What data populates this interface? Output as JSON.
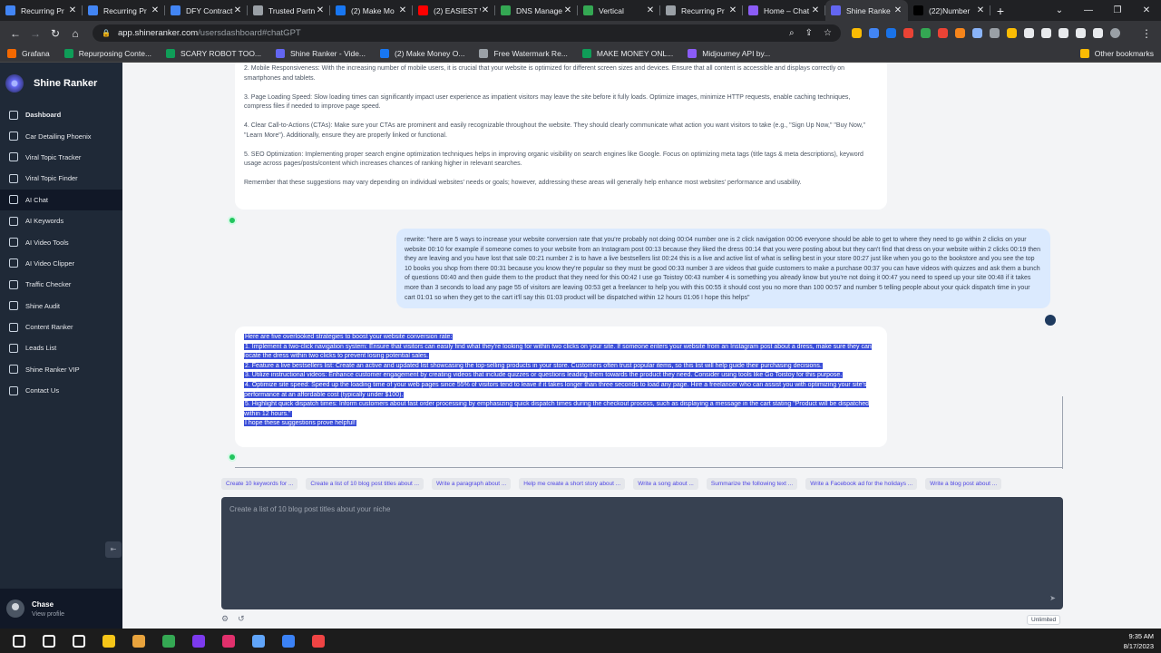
{
  "browser": {
    "tabs": [
      {
        "label": "Recurring Pr",
        "icon": "docs-icon",
        "color": "#4285f4"
      },
      {
        "label": "Recurring Pr",
        "icon": "docs-icon",
        "color": "#4285f4"
      },
      {
        "label": "DFY Contract",
        "icon": "docs-icon",
        "color": "#4285f4"
      },
      {
        "label": "Trusted Partn",
        "icon": "page-icon",
        "color": "#9aa0a6"
      },
      {
        "label": "(2) Make Mo",
        "icon": "facebook-icon",
        "color": "#1877f2"
      },
      {
        "label": "(2) EASIEST W",
        "icon": "youtube-icon",
        "color": "#ff0000"
      },
      {
        "label": "DNS Manage",
        "icon": "globe-icon",
        "color": "#34a853"
      },
      {
        "label": "Vertical",
        "icon": "globe-icon",
        "color": "#34a853"
      },
      {
        "label": "Recurring Pr",
        "icon": "page-icon",
        "color": "#9aa0a6"
      },
      {
        "label": "Home – Chat",
        "icon": "s-icon",
        "color": "#8b5cf6"
      },
      {
        "label": "Shine Ranke",
        "icon": "shine-ranker-icon",
        "color": "#6366f1",
        "active": true
      },
      {
        "label": "(22)Number",
        "icon": "tiktok-icon",
        "color": "#000000"
      }
    ],
    "url_host": "app.shineranker.com",
    "url_path": "/usersdashboard#chatGPT",
    "bookmarks": [
      {
        "label": "Grafana",
        "color": "#f46800"
      },
      {
        "label": "Repurposing Conte...",
        "color": "#0f9d58"
      },
      {
        "label": "SCARY ROBOT TOO...",
        "color": "#0f9d58"
      },
      {
        "label": "Shine Ranker - Vide...",
        "color": "#6366f1"
      },
      {
        "label": "(2) Make Money O...",
        "color": "#1877f2"
      },
      {
        "label": "Free Watermark Re...",
        "color": "#9aa0a6"
      },
      {
        "label": "MAKE MONEY ONL...",
        "color": "#0f9d58"
      },
      {
        "label": "Midjourney API by...",
        "color": "#8b5cf6"
      }
    ],
    "other_bookmarks": "Other bookmarks"
  },
  "sidebar": {
    "brand": "Shine Ranker",
    "items": [
      {
        "label": "Dashboard",
        "active": false,
        "bold": true
      },
      {
        "label": "Car Detailing Phoenix"
      },
      {
        "label": "Viral Topic Tracker"
      },
      {
        "label": "Viral Topic Finder"
      },
      {
        "label": "AI Chat",
        "active": true
      },
      {
        "label": "AI Keywords"
      },
      {
        "label": "AI Video Tools"
      },
      {
        "label": "AI Video Clipper"
      },
      {
        "label": "Traffic Checker"
      },
      {
        "label": "Shine Audit"
      },
      {
        "label": "Content Ranker"
      },
      {
        "label": "Leads List"
      },
      {
        "label": "Shine Ranker VIP"
      },
      {
        "label": "Contact Us"
      }
    ],
    "user": {
      "name": "Chase",
      "link": "View profile"
    }
  },
  "chat": {
    "assistant_prev": [
      "2. Mobile Responsiveness: With the increasing number of mobile users, it is crucial that your website is optimized for different screen sizes and devices. Ensure that all content is accessible and displays correctly on smartphones and tablets.",
      "3. Page Loading Speed: Slow loading times can significantly impact user experience as impatient visitors may leave the site before it fully loads. Optimize images, minimize HTTP requests, enable caching techniques, compress files if needed to improve page speed.",
      "4. Clear Call-to-Actions (CTAs): Make sure your CTAs are prominent and easily recognizable throughout the website. They should clearly communicate what action you want visitors to take (e.g., \"Sign Up Now,\" \"Buy Now,\" \"Learn More\"). Additionally, ensure they are properly linked or functional.",
      "5. SEO Optimization: Implementing proper search engine optimization techniques helps in improving organic visibility on search engines like Google. Focus on optimizing meta tags (title tags & meta descriptions), keyword usage across pages/posts/content which increases chances of ranking higher in relevant searches.",
      "Remember that these suggestions may vary depending on individual websites' needs or goals; however, addressing these areas will generally help enhance most websites' performance and usability."
    ],
    "user_message": "rewrite: \"here are 5 ways to increase your website conversion rate that you're probably not doing 00:04 number one is 2 click navigation 00:06 everyone should be able to get to where they need to go within 2 clicks on your website 00:10 for example if someone comes to your website from an Instagram post 00:13 because they liked the dress 00:14 that you were posting about but they can't find that dress on your website within 2 clicks 00:19 then they are leaving and you have lost that sale 00:21 number 2 is to have a live bestsellers list 00:24 this is a live and active list of what is selling best in your store 00:27 just like when you go to the bookstore and you see the top 10 books you shop from there 00:31 because you know they're popular so they must be good 00:33 number 3 are videos that guide customers to make a purchase 00:37 you can have videos with quizzes and ask them a bunch of questions 00:40 and then guide them to the product that they need for this 00:42 I use go Toistoy 00:43 number 4 is something you already know but you're not doing it 00:47 you need to speed up your site 00:48 if it takes more than 3 seconds to load any page 55 of visitors are leaving 00:53 get a freelancer to help you with this 00:55 it should cost you no more than 100 00:57 and number 5 telling people about your quick dispatch time in your cart 01:01 so when they get to the cart it'll say this 01:03 product will be dispatched within 12 hours 01:06 I hope this helps\"",
    "assistant_reply": [
      "Here are five overlooked strategies to boost your website conversion rate:",
      "1. Implement a two-click navigation system: Ensure that visitors can easily find what they're looking for within two clicks on your site. If someone enters your website from an Instagram post about a dress, make sure they can locate the dress within two clicks to prevent losing potential sales.",
      "2. Feature a live bestsellers list: Create an active and updated list showcasing the top-selling products in your store. Customers often trust popular items, so this list will help guide their purchasing decisions.",
      "3. Utilize instructional videos: Enhance customer engagement by creating videos that include quizzes or questions leading them towards the product they need. Consider using tools like Go Toistoy for this purpose.",
      "4. Optimize site speed: Speed up the loading time of your web pages since 55% of visitors tend to leave if it takes longer than three seconds to load any page. Hire a freelancer who can assist you with optimizing your site's performance at an affordable cost (typically under $100).",
      "5. Highlight quick dispatch times: Inform customers about fast order processing by emphasizing quick dispatch times during the checkout process, such as displaying a message in the cart stating \"Product will be dispatched within 12 hours.\"",
      "I hope these suggestions prove helpful!"
    ],
    "suggestions": [
      "Create 10 keywords for ...",
      "Create a list of 10 blog post titles about ...",
      "Write a paragraph about ...",
      "Help me create a short story about ...",
      "Write a song about ...",
      "Summarize the following text ...",
      "Write a Facebook ad for the holidays ...",
      "Write a blog post about ..."
    ],
    "composer_placeholder": "Create a list of 10 blog post titles about your niche",
    "plan_badge": "Unlimited"
  },
  "taskbar": {
    "time": "9:35 AM",
    "date": "8/17/2023",
    "apps": [
      {
        "icon": "windows-start-icon",
        "color": "#ffffff"
      },
      {
        "icon": "search-icon",
        "color": "#ffffff"
      },
      {
        "icon": "task-view-icon",
        "color": "#ffffff"
      },
      {
        "icon": "file-explorer-icon",
        "color": "#f5c518"
      },
      {
        "icon": "media-player-icon",
        "color": "#e8a33d"
      },
      {
        "icon": "chrome-icon",
        "color": "#34a853"
      },
      {
        "icon": "chat-app-icon",
        "color": "#7c3aed"
      },
      {
        "icon": "instagram-icon",
        "color": "#e1306c"
      },
      {
        "icon": "notes-app-icon",
        "color": "#60a5fa"
      },
      {
        "icon": "video-editor-icon",
        "color": "#3b82f6"
      },
      {
        "icon": "recorder-icon",
        "color": "#ef4444"
      }
    ]
  }
}
